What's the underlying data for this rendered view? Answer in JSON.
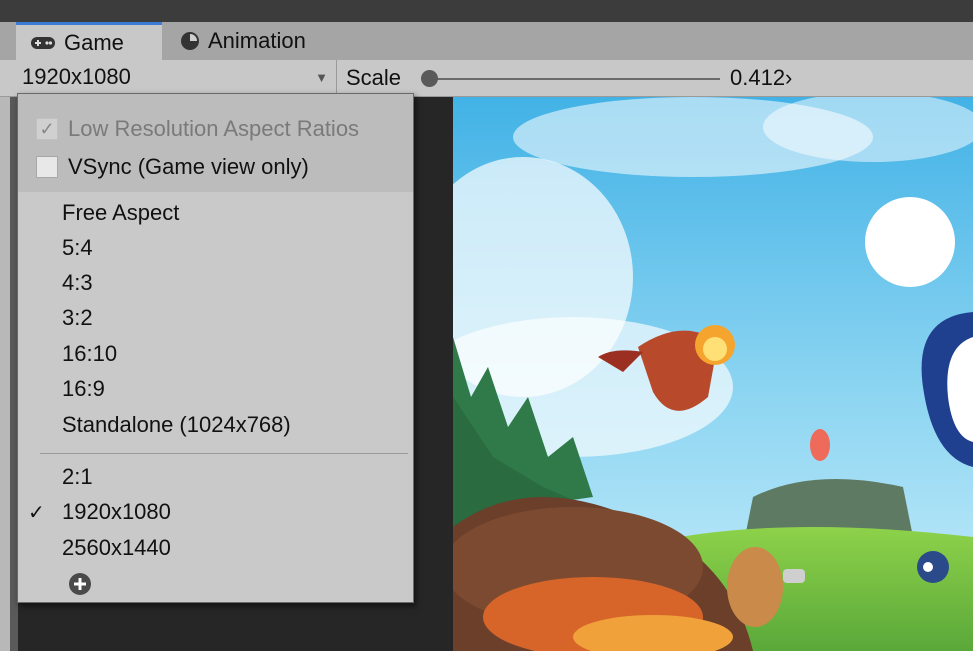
{
  "tabs": [
    {
      "label": "Game",
      "icon": "gamepad-icon",
      "active": true
    },
    {
      "label": "Animation",
      "icon": "animation-clock-icon",
      "active": false
    }
  ],
  "toolbar": {
    "resolution_value": "1920x1080",
    "scale_label": "Scale",
    "scale_value": "0.412›"
  },
  "dropdown": {
    "options": [
      {
        "label": "Low Resolution Aspect Ratios",
        "checked": true,
        "disabled": true
      },
      {
        "label": "VSync (Game view only)",
        "checked": false,
        "disabled": false
      }
    ],
    "group1": [
      "Free Aspect",
      "5:4",
      "4:3",
      "3:2",
      "16:10",
      "16:9",
      "Standalone (1024x768)"
    ],
    "group2": [
      "2:1",
      "1920x1080",
      "2560x1440"
    ],
    "selected": "1920x1080",
    "check_glyph": "✓",
    "add_icon": "plus-circle-icon"
  },
  "colors": {
    "accent_tab": "#3d7bd9",
    "menu_bg": "#c9c9c9",
    "toolbar_bg": "#c8c8c8"
  }
}
